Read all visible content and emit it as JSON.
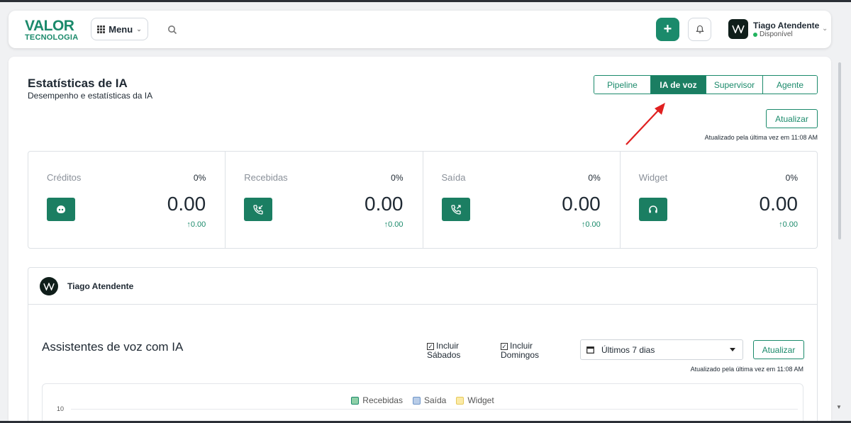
{
  "header": {
    "logo_top": "VALOR",
    "logo_bottom": "TECNOLOGIA",
    "menu_label": "Menu",
    "user": {
      "name": "Tiago Atendente",
      "status": "Disponível"
    }
  },
  "page": {
    "title": "Estatísticas de IA",
    "subtitle": "Desempenho e estatísticas da IA",
    "tabs": [
      {
        "label": "Pipeline",
        "active": false
      },
      {
        "label": "IA de voz",
        "active": true
      },
      {
        "label": "Supervisor",
        "active": false
      },
      {
        "label": "Agente",
        "active": false
      }
    ],
    "refresh_label": "Atualizar",
    "updated_note": "Atualizado pela última vez em 11:08 AM"
  },
  "stats": [
    {
      "label": "Créditos",
      "percent": "0%",
      "value": "0.00",
      "delta": "0.00",
      "icon": "robot-icon"
    },
    {
      "label": "Recebidas",
      "percent": "0%",
      "value": "0.00",
      "delta": "0.00",
      "icon": "incoming-call-icon"
    },
    {
      "label": "Saída",
      "percent": "0%",
      "value": "0.00",
      "delta": "0.00",
      "icon": "outgoing-call-icon"
    },
    {
      "label": "Widget",
      "percent": "0%",
      "value": "0.00",
      "delta": "0.00",
      "icon": "headset-icon"
    }
  ],
  "assistants": {
    "user_name": "Tiago Atendente",
    "title": "Assistentes de voz com IA",
    "include_saturdays_line1": "Incluir",
    "include_saturdays_line2": "Sábados",
    "include_sundays_line1": "Incluir",
    "include_sundays_line2": "Domingos",
    "date_range": "Últimos 7 dias",
    "refresh_label": "Atualizar",
    "updated_note": "Atualizado pela última vez em 11:08 AM"
  },
  "chart_legend": [
    {
      "name": "Recebidas",
      "fill": "#8fd0a8",
      "stroke": "#1b8a6b"
    },
    {
      "name": "Saída",
      "fill": "#b9cde8",
      "stroke": "#6e95c8"
    },
    {
      "name": "Widget",
      "fill": "#fbeaa6",
      "stroke": "#e6c95a"
    }
  ],
  "chart_y_tick": "10",
  "colors": {
    "brand": "#1b8a6b",
    "active_tab": "#1b7e62"
  }
}
